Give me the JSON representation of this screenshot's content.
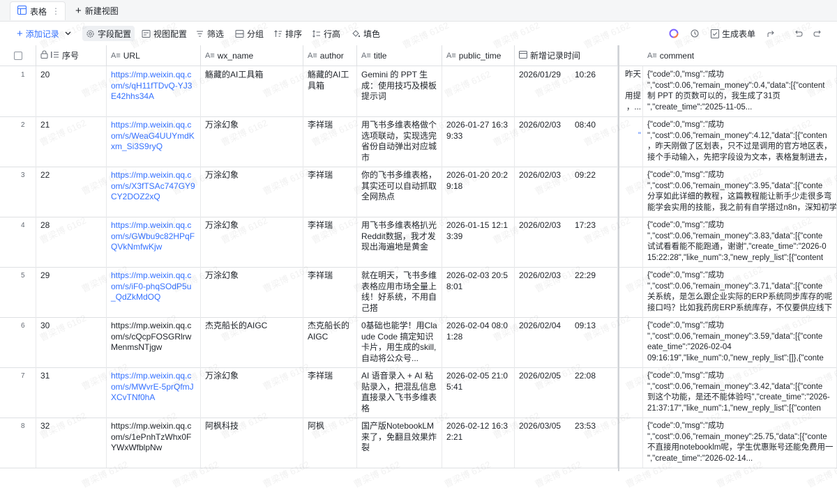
{
  "tabs": [
    {
      "label": "表格",
      "more": "⋮"
    },
    {
      "label": "新建视图",
      "prefix": "+"
    }
  ],
  "toolbar": {
    "add_record": "添加记录",
    "field_config": "字段配置",
    "view_config": "视图配置",
    "filter": "筛选",
    "group": "分组",
    "sort": "排序",
    "row_height": "行高",
    "fill_color": "填色",
    "gen_form": "生成表单"
  },
  "colors": {
    "accent": "#3370ff",
    "border": "#dee0e3",
    "header_bg": "#f5f6f7"
  },
  "columns": {
    "seq": "序号",
    "url": "URL",
    "wx_name": "wx_name",
    "author": "author",
    "title": "title",
    "public_time": "public_time",
    "created": "新增记录时间",
    "comment": "comment"
  },
  "rows": [
    {
      "rn": "1",
      "seq": "20",
      "url": "https://mp.weixin.qq.com/s/qH11fTDvQ-YJ3E42hhs34A",
      "url_is_link": true,
      "wx_name": "觞藏的AI工具箱",
      "author": "觞藏的AI工具箱",
      "title": "Gemini 的 PPT 生成：使用技巧及模板提示词",
      "public_time": "",
      "created_date": "2026/01/29",
      "created_time": "10:26",
      "clip": "昨天\n\n用提\n，...",
      "comment": "{\"code\":0,\"msg\":\"成功\n\",\"cost\":0.06,\"remain_money\":0.4,\"data\":[{\"content\n制 PPT 的页数可以的，我生成了31页\n\",\"create_time\":\"2025-11-05..."
    },
    {
      "rn": "2",
      "seq": "21",
      "url": "https://mp.weixin.qq.com/s/WeaG4UUYmdKxm_Si3S9ryQ",
      "url_is_link": true,
      "wx_name": "万涂幻象",
      "author": "李祥瑞",
      "title": "用飞书多维表格做个选项联动，实现选完省份自动弹出对应城市",
      "public_time": "2026-01-27 16:39:33",
      "created_date": "2026/02/03",
      "created_time": "08:40",
      "clip": "\n\"",
      "comment": "{\"code\":0,\"msg\":\"成功\n\",\"cost\":0.06,\"remain_money\":4.12,\"data\":[{\"conten\n，昨天刚做了区划表，只不过是调用的官方地区表，\n接个手动输入，先把字段设为文本，表格复制进去，"
    },
    {
      "rn": "3",
      "seq": "22",
      "url": "https://mp.weixin.qq.com/s/X3fTSAc747GY9CY2DOZ2xQ",
      "url_is_link": true,
      "wx_name": "万涂幻象",
      "author": "李祥瑞",
      "title": "你的飞书多维表格，其实还可以自动抓取全网热点",
      "public_time": "2026-01-20 20:29:18",
      "created_date": "2026/02/03",
      "created_time": "09:22",
      "clip": "",
      "comment": "{\"code\":0,\"msg\":\"成功\n\",\"cost\":0.06,\"remain_money\":3.95,\"data\":[{\"conte\n分享如此详细的教程，这篇教程能让新手少走很多弯\n能学会实用的技能，我之前有自学搭过n8n，深知初学"
    },
    {
      "rn": "4",
      "seq": "28",
      "url": "https://mp.weixin.qq.com/s/GWbu9c82HPqFQVkNmfwKjw",
      "url_is_link": true,
      "wx_name": "万涂幻象",
      "author": "李祥瑞",
      "title": "用飞书多维表格扒光Reddit数据，我才发现出海遍地是黄金",
      "public_time": "2026-01-15 12:13:39",
      "created_date": "2026/02/03",
      "created_time": "17:23",
      "clip": "",
      "comment": "{\"code\":0,\"msg\":\"成功\n\",\"cost\":0.06,\"remain_money\":3.83,\"data\":[{\"conte\n试试看看能不能跑通，谢谢\",\"create_time\":\"2026-0\n15:22:28\",\"like_num\":3,\"new_reply_list\":[{\"content"
    },
    {
      "rn": "5",
      "seq": "29",
      "url": "https://mp.weixin.qq.com/s/iF0-phqSOdP5u_QdZkMdOQ",
      "url_is_link": true,
      "wx_name": "万涂幻象",
      "author": "李祥瑞",
      "title": "就在明天，飞书多维表格应用市场全量上线！好系统，不用自己搭",
      "public_time": "2026-02-03 20:58:01",
      "created_date": "2026/02/03",
      "created_time": "22:29",
      "clip": "",
      "comment": "{\"code\":0,\"msg\":\"成功\n\",\"cost\":0.06,\"remain_money\":3.71,\"data\":[{\"conte\n关系统，是怎么跟企业实际的ERP系统同步库存的呢\n接口吗？比如我药房ERP系统库存，不仅要供应线下"
    },
    {
      "rn": "6",
      "seq": "30",
      "url": "https://mp.weixin.qq.com/s/cQcpFOSGRlrwMenmsNTjgw",
      "url_is_link": false,
      "wx_name": "杰克船长的AIGC",
      "author": "杰克船长的AIGC",
      "title": "0基础也能学！用Claude Code 搞定知识卡片，用生成的skill,自动将公众号...",
      "public_time": "2026-02-04 08:01:28",
      "created_date": "2026/02/04",
      "created_time": "09:13",
      "clip": "",
      "comment": "{\"code\":0,\"msg\":\"成功\n\",\"cost\":0.06,\"remain_money\":3.59,\"data\":[{\"conte\neate_time\":\"2026-02-04\n09:16:19\",\"like_num\":0,\"new_reply_list\":[]},{\"conte"
    },
    {
      "rn": "7",
      "seq": "31",
      "url": "https://mp.weixin.qq.com/s/MWvrE-5prQfmJXCvTNf0hA",
      "url_is_link": true,
      "wx_name": "万涂幻象",
      "author": "李祥瑞",
      "title": "AI 语音录入 + AI 粘贴录入，把混乱信息直接录入飞书多维表格",
      "public_time": "2026-02-05 21:05:41",
      "created_date": "2026/02/05",
      "created_time": "22:08",
      "clip": "",
      "comment": "{\"code\":0,\"msg\":\"成功\n\",\"cost\":0.06,\"remain_money\":3.42,\"data\":[{\"conte\n到这个功能，是还不能体验吗\",\"create_time\":\"2026-\n21:37:17\",\"like_num\":1,\"new_reply_list\":[{\"conten"
    },
    {
      "rn": "8",
      "seq": "32",
      "url": "https://mp.weixin.qq.com/s/1ePnhTzWhx0FYWxWfblpNw",
      "url_is_link": false,
      "wx_name": "阿枫科技",
      "author": "阿枫",
      "title": "国产版NotebookLM来了，免翻且效果炸裂",
      "public_time": "2026-02-12 16:32:21",
      "created_date": "2026/03/05",
      "created_time": "23:53",
      "clip": "",
      "comment": "{\"code\":0,\"msg\":\"成功\n\",\"cost\":0.06,\"remain_money\":25.75,\"data\":[{\"conte\n不直接用notebooklm呢，学生优惠账号还能免费用一\n\",\"create_time\":\"2026-02-14..."
    }
  ],
  "watermark": "曹梁博 6162"
}
